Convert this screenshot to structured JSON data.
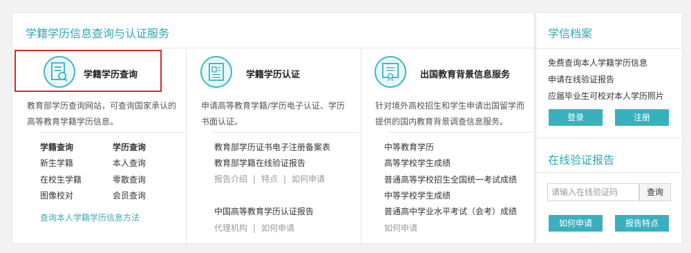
{
  "main": {
    "title": "学籍学历信息查询与认证服务",
    "query": {
      "title": "学籍学历查询",
      "desc": "教育部学历查询网站，可查询国家承认的高等教育学籍学历信息。",
      "links_left": [
        "学籍查询",
        "新生学籍",
        "在校生学籍",
        "图像校对"
      ],
      "links_right": [
        "学历查询",
        "本人查询",
        "零散查询",
        "会员查询"
      ],
      "method_link": "查询本人学籍学历信息方法"
    },
    "cert": {
      "title": "学籍学历认证",
      "desc": "申请高等教育学籍/学历电子认证、学历书面认证。",
      "link1": "教育部学历证书电子注册备案表",
      "link2": "教育部学籍在线验证报告",
      "sub1": [
        "报告介绍",
        "特点",
        "如何申请"
      ],
      "link3": "中国高等教育学历认证报告",
      "sub2": [
        "代理机构",
        "如何申请"
      ]
    },
    "abroad": {
      "title": "出国教育背景信息服务",
      "desc": "针对境外高校招生和学生申请出国留学而提供的国内教育背景调查信息服务。",
      "links": [
        "中等教育学历",
        "高等学校学生成绩",
        "普通高等学校招生全国统一考试成绩",
        "中等学校学生成绩",
        "普通高中学业水平考试（会考）成绩",
        "如何申请"
      ]
    }
  },
  "side": {
    "archive_title": "学信档案",
    "archive_lines": [
      "免费查询本人学籍学历信息",
      "申请在线验证报告",
      "应届毕业生可校对本人学历照片"
    ],
    "login": "登录",
    "register": "注册",
    "verify_title": "在线验证报告",
    "verify_placeholder": "请输入在线验证码",
    "query_btn": "查询",
    "how_apply": "如何申请",
    "features": "报告特点"
  }
}
